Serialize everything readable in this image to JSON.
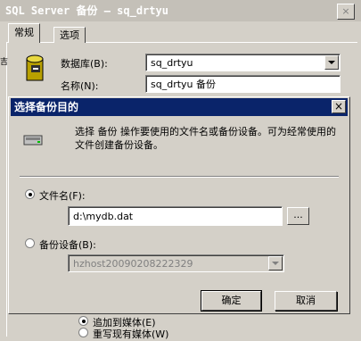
{
  "parent": {
    "title": "SQL Server 备份 — sq_drtyu",
    "tabs": [
      "常规",
      "选项"
    ],
    "database_label": "数据库(B):",
    "database_value": "sq_drtyu",
    "name_label": "名称(N):",
    "name_value": "sq_drtyu 备份",
    "bottom_option_1": "追加到媒体(E)",
    "bottom_option_2": "重写现有媒体(W)"
  },
  "dialog": {
    "title": "选择备份目的",
    "close_glyph": "×",
    "description": "选择 备份 操作要使用的文件名或备份设备。可为经常使用的文件创建备份设备。",
    "file_radio_label": "文件名(F):",
    "file_value": "d:\\mydb.dat",
    "browse_label": "...",
    "device_radio_label": "备份设备(B):",
    "device_value": "hzhost20090208222329",
    "ok_label": "确定",
    "cancel_label": "取消"
  }
}
